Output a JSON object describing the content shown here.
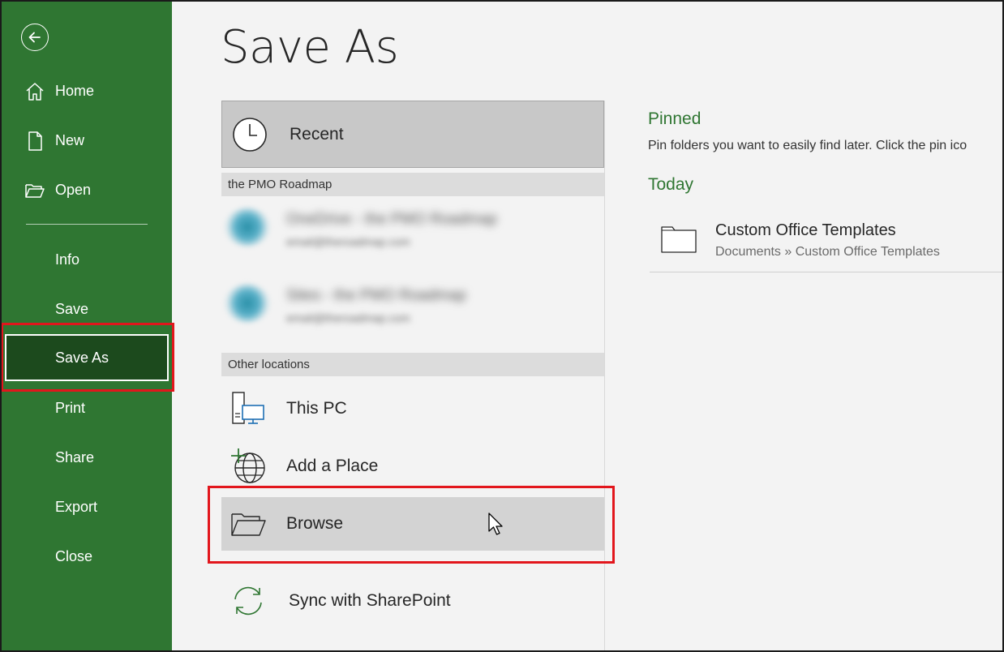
{
  "sidebar": {
    "back_icon": "arrow-left-circle-icon",
    "items_top": [
      {
        "label": "Home",
        "icon": "home-icon"
      },
      {
        "label": "New",
        "icon": "new-document-icon"
      },
      {
        "label": "Open",
        "icon": "open-folder-icon"
      }
    ],
    "items_bottom": [
      {
        "label": "Info"
      },
      {
        "label": "Save"
      },
      {
        "label": "Save As",
        "active": true
      },
      {
        "label": "Print"
      },
      {
        "label": "Share"
      },
      {
        "label": "Export"
      },
      {
        "label": "Close"
      }
    ],
    "background_color": "#2f7632",
    "active_color": "#1c4a1d"
  },
  "main": {
    "title": "Save As",
    "recent": {
      "label": "Recent",
      "icon": "clock-icon"
    },
    "pmo_section": {
      "header": "the PMO Roadmap",
      "items": [
        {
          "title": "OneDrive - the PMO Roadmap",
          "subtitle": "email@theroadmap.com",
          "blurred": true
        },
        {
          "title": "Sites - the PMO Roadmap",
          "subtitle": "email@theroadmap.com",
          "blurred": true
        }
      ]
    },
    "other_section": {
      "header": "Other locations",
      "items": [
        {
          "label": "This PC",
          "icon": "computer-icon"
        },
        {
          "label": "Add a Place",
          "icon": "add-globe-icon"
        },
        {
          "label": "Browse",
          "icon": "folder-open-icon"
        }
      ]
    },
    "sync": {
      "label": "Sync with SharePoint",
      "icon": "sync-icon"
    }
  },
  "right_pane": {
    "pinned_title": "Pinned",
    "pinned_desc": "Pin folders you want to easily find later. Click the pin ico",
    "today_title": "Today",
    "today_items": [
      {
        "name": "Custom Office Templates",
        "path": "Documents » Custom Office Templates",
        "icon": "folder-icon"
      }
    ],
    "accent_color": "#2f7632"
  },
  "annotations": {
    "highlight_color": "#e2161c"
  }
}
